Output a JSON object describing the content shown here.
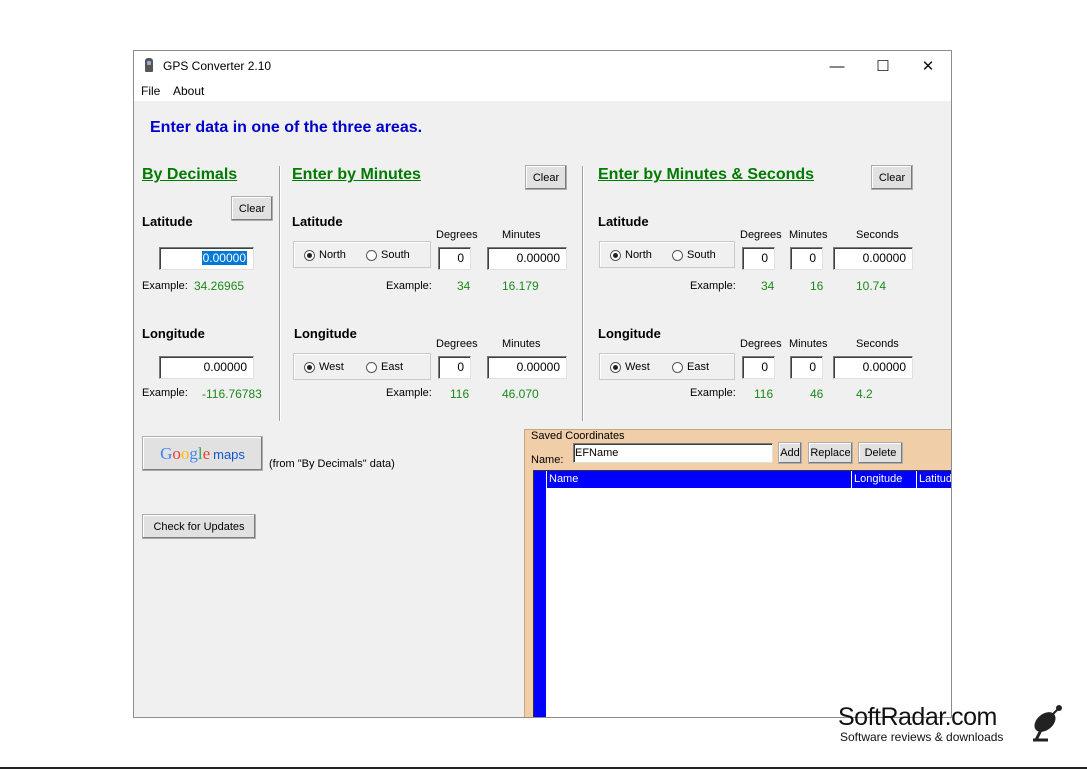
{
  "window": {
    "title": "GPS Converter 2.10",
    "minimize": "—",
    "maximize": "☐",
    "close": "✕"
  },
  "menu": [
    "File",
    "About"
  ],
  "heading": "Enter data in one of the three areas.",
  "decimals": {
    "title": "By Decimals",
    "clear": "Clear",
    "latitude_label": "Latitude",
    "latitude_value": "0.00000",
    "example_label": "Example:",
    "latitude_example": "34.26965",
    "longitude_label": "Longitude",
    "longitude_value": "0.00000",
    "longitude_example": "-116.76783"
  },
  "minutes": {
    "title": "Enter by Minutes",
    "clear": "Clear",
    "latitude_label": "Latitude",
    "north": "North",
    "south": "South",
    "degrees_label": "Degrees",
    "minutes_label": "Minutes",
    "lat_degrees": "0",
    "lat_minutes": "0.00000",
    "example_label": "Example:",
    "lat_example_deg": "34",
    "lat_example_min": "16.179",
    "longitude_label": "Longitude",
    "west": "West",
    "east": "East",
    "lon_degrees": "0",
    "lon_minutes": "0.00000",
    "lon_example_deg": "116",
    "lon_example_min": "46.070"
  },
  "seconds": {
    "title": "Enter by Minutes & Seconds",
    "clear": "Clear",
    "latitude_label": "Latitude",
    "north": "North",
    "south": "South",
    "degrees_label": "Degrees",
    "minutes_label": "Minutes",
    "seconds_label": "Seconds",
    "lat_degrees": "0",
    "lat_minutes": "0",
    "lat_seconds": "0.00000",
    "example_label": "Example:",
    "lat_example_deg": "34",
    "lat_example_min": "16",
    "lat_example_sec": "10.74",
    "longitude_label": "Longitude",
    "west": "West",
    "east": "East",
    "lon_degrees": "0",
    "lon_minutes": "0",
    "lon_seconds": "0.00000",
    "lon_example_deg": "116",
    "lon_example_min": "46",
    "lon_example_sec": "4.2"
  },
  "google": {
    "brand": "Google",
    "maps": "maps",
    "note": "(from \"By Decimals\" data)"
  },
  "updates_button": "Check for Updates",
  "saved": {
    "title": "Saved Coordinates",
    "name_label": "Name:",
    "name_value": "EFName",
    "add": "Add",
    "replace": "Replace",
    "delete": "Delete",
    "columns": [
      "Name",
      "Longitude",
      "Latitud"
    ]
  },
  "watermark": {
    "name": "SoftRadar.com",
    "tagline": "Software reviews & downloads"
  },
  "colors": {
    "heading": "#0000cc",
    "section": "#007a00",
    "example": "#1a8a1a",
    "list_header": "#0000ff",
    "saved_bg": "#f0cfa8"
  }
}
